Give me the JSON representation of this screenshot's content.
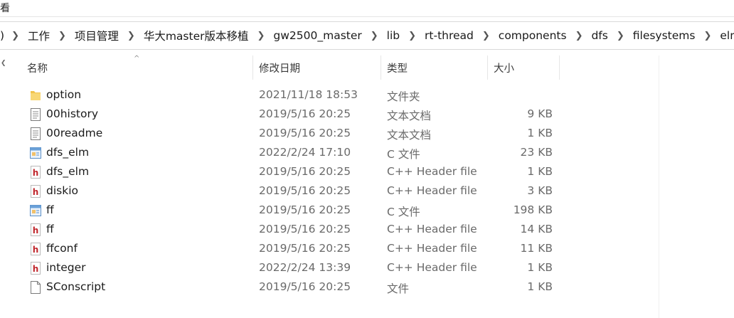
{
  "ribbon": {
    "partial_label": "看"
  },
  "breadcrumb": {
    "lead": ")",
    "items": [
      "工作",
      "项目管理",
      "华大master版本移植",
      "gw2500_master",
      "lib",
      "rt-thread",
      "components",
      "dfs",
      "filesystems",
      "elmfat"
    ]
  },
  "columns": {
    "name": "名称",
    "date": "修改日期",
    "type": "类型",
    "size": "大小"
  },
  "files": [
    {
      "name": "option",
      "date": "2021/11/18 18:53",
      "type": "文件夹",
      "size": "",
      "icon": "folder-icon"
    },
    {
      "name": "00history",
      "date": "2019/5/16 20:25",
      "type": "文本文档",
      "size": "9 KB",
      "icon": "text-document-icon"
    },
    {
      "name": "00readme",
      "date": "2019/5/16 20:25",
      "type": "文本文档",
      "size": "1 KB",
      "icon": "text-document-icon"
    },
    {
      "name": "dfs_elm",
      "date": "2022/2/24 17:10",
      "type": "C 文件",
      "size": "23 KB",
      "icon": "c-source-file-icon"
    },
    {
      "name": "dfs_elm",
      "date": "2019/5/16 20:25",
      "type": "C++ Header file",
      "size": "1 KB",
      "icon": "header-file-icon"
    },
    {
      "name": "diskio",
      "date": "2019/5/16 20:25",
      "type": "C++ Header file",
      "size": "3 KB",
      "icon": "header-file-icon"
    },
    {
      "name": "ff",
      "date": "2019/5/16 20:25",
      "type": "C 文件",
      "size": "198 KB",
      "icon": "c-source-file-icon"
    },
    {
      "name": "ff",
      "date": "2019/5/16 20:25",
      "type": "C++ Header file",
      "size": "14 KB",
      "icon": "header-file-icon"
    },
    {
      "name": "ffconf",
      "date": "2019/5/16 20:25",
      "type": "C++ Header file",
      "size": "11 KB",
      "icon": "header-file-icon"
    },
    {
      "name": "integer",
      "date": "2022/2/24 13:39",
      "type": "C++ Header file",
      "size": "1 KB",
      "icon": "header-file-icon"
    },
    {
      "name": "SConscript",
      "date": "2019/5/16 20:25",
      "type": "文件",
      "size": "1 KB",
      "icon": "generic-file-icon"
    }
  ],
  "colors": {
    "folder": "#f1c34d",
    "header_h": "#c0262c",
    "text_secondary": "#6a6a6a"
  }
}
